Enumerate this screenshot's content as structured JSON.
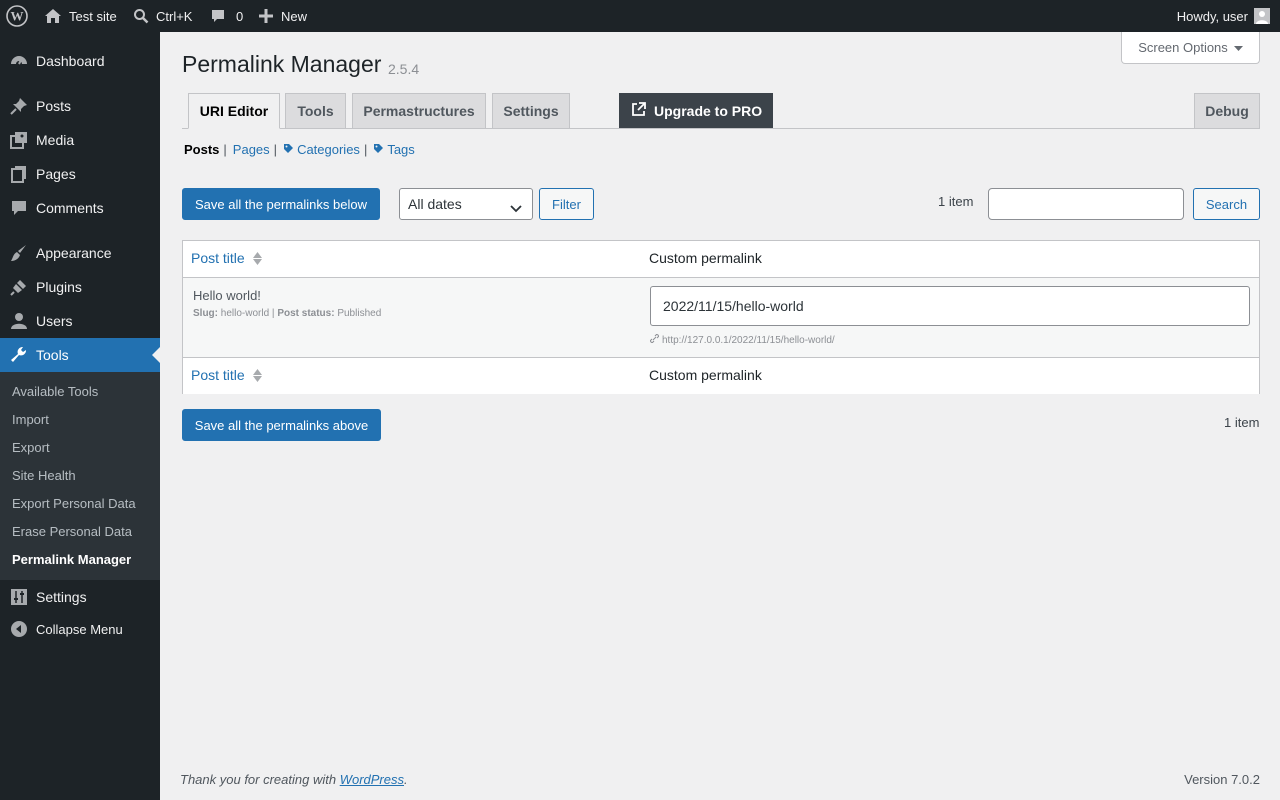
{
  "adminbar": {
    "site_name": "Test site",
    "search_shortcut": "Ctrl+K",
    "comments_count": "0",
    "new_label": "New",
    "howdy": "Howdy, user"
  },
  "sidebar": {
    "items": [
      {
        "label": "Dashboard",
        "icon": "dashboard-icon"
      },
      {
        "label": "Posts",
        "icon": "pin-icon"
      },
      {
        "label": "Media",
        "icon": "media-icon"
      },
      {
        "label": "Pages",
        "icon": "pages-icon"
      },
      {
        "label": "Comments",
        "icon": "comments-icon"
      },
      {
        "label": "Appearance",
        "icon": "brush-icon"
      },
      {
        "label": "Plugins",
        "icon": "plugin-icon"
      },
      {
        "label": "Users",
        "icon": "user-icon"
      },
      {
        "label": "Tools",
        "icon": "wrench-icon"
      },
      {
        "label": "Settings",
        "icon": "sliders-icon"
      },
      {
        "label": "Collapse Menu",
        "icon": "collapse-icon"
      }
    ],
    "submenu": [
      "Available Tools",
      "Import",
      "Export",
      "Site Health",
      "Export Personal Data",
      "Erase Personal Data",
      "Permalink Manager"
    ]
  },
  "screen_options": "Screen Options",
  "page": {
    "title": "Permalink Manager",
    "version": "2.5.4"
  },
  "tabs": [
    "URI Editor",
    "Tools",
    "Permastructures",
    "Settings"
  ],
  "upgrade_label": "Upgrade to PRO",
  "debug_label": "Debug",
  "subsubsub": {
    "posts": "Posts",
    "pages": "Pages",
    "categories": "Categories",
    "tags": "Tags",
    "sep": "|"
  },
  "toolbar": {
    "save_below": "Save all the permalinks below",
    "save_above": "Save all the permalinks above",
    "dates_select": "All dates",
    "filter": "Filter",
    "item_count": "1 item",
    "search": "Search",
    "search_value": ""
  },
  "table": {
    "col_title": "Post title",
    "col_permalink": "Custom permalink",
    "rows": [
      {
        "title": "Hello world!",
        "slug_label": "Slug:",
        "slug": "hello-world",
        "status_label": "Post status:",
        "status": "Published",
        "uri": "2022/11/15/hello-world",
        "url": "http://127.0.0.1/2022/11/15/hello-world/"
      }
    ]
  },
  "footer": {
    "thanks_prefix": "Thank you for creating with ",
    "wordpress_link": "WordPress",
    "thanks_suffix": ".",
    "version": "Version 7.0.2"
  },
  "colors": {
    "accent": "#2271b1",
    "admin_dark": "#1d2327",
    "submenu_bg": "#2c3338",
    "background": "#f0f0f1"
  }
}
